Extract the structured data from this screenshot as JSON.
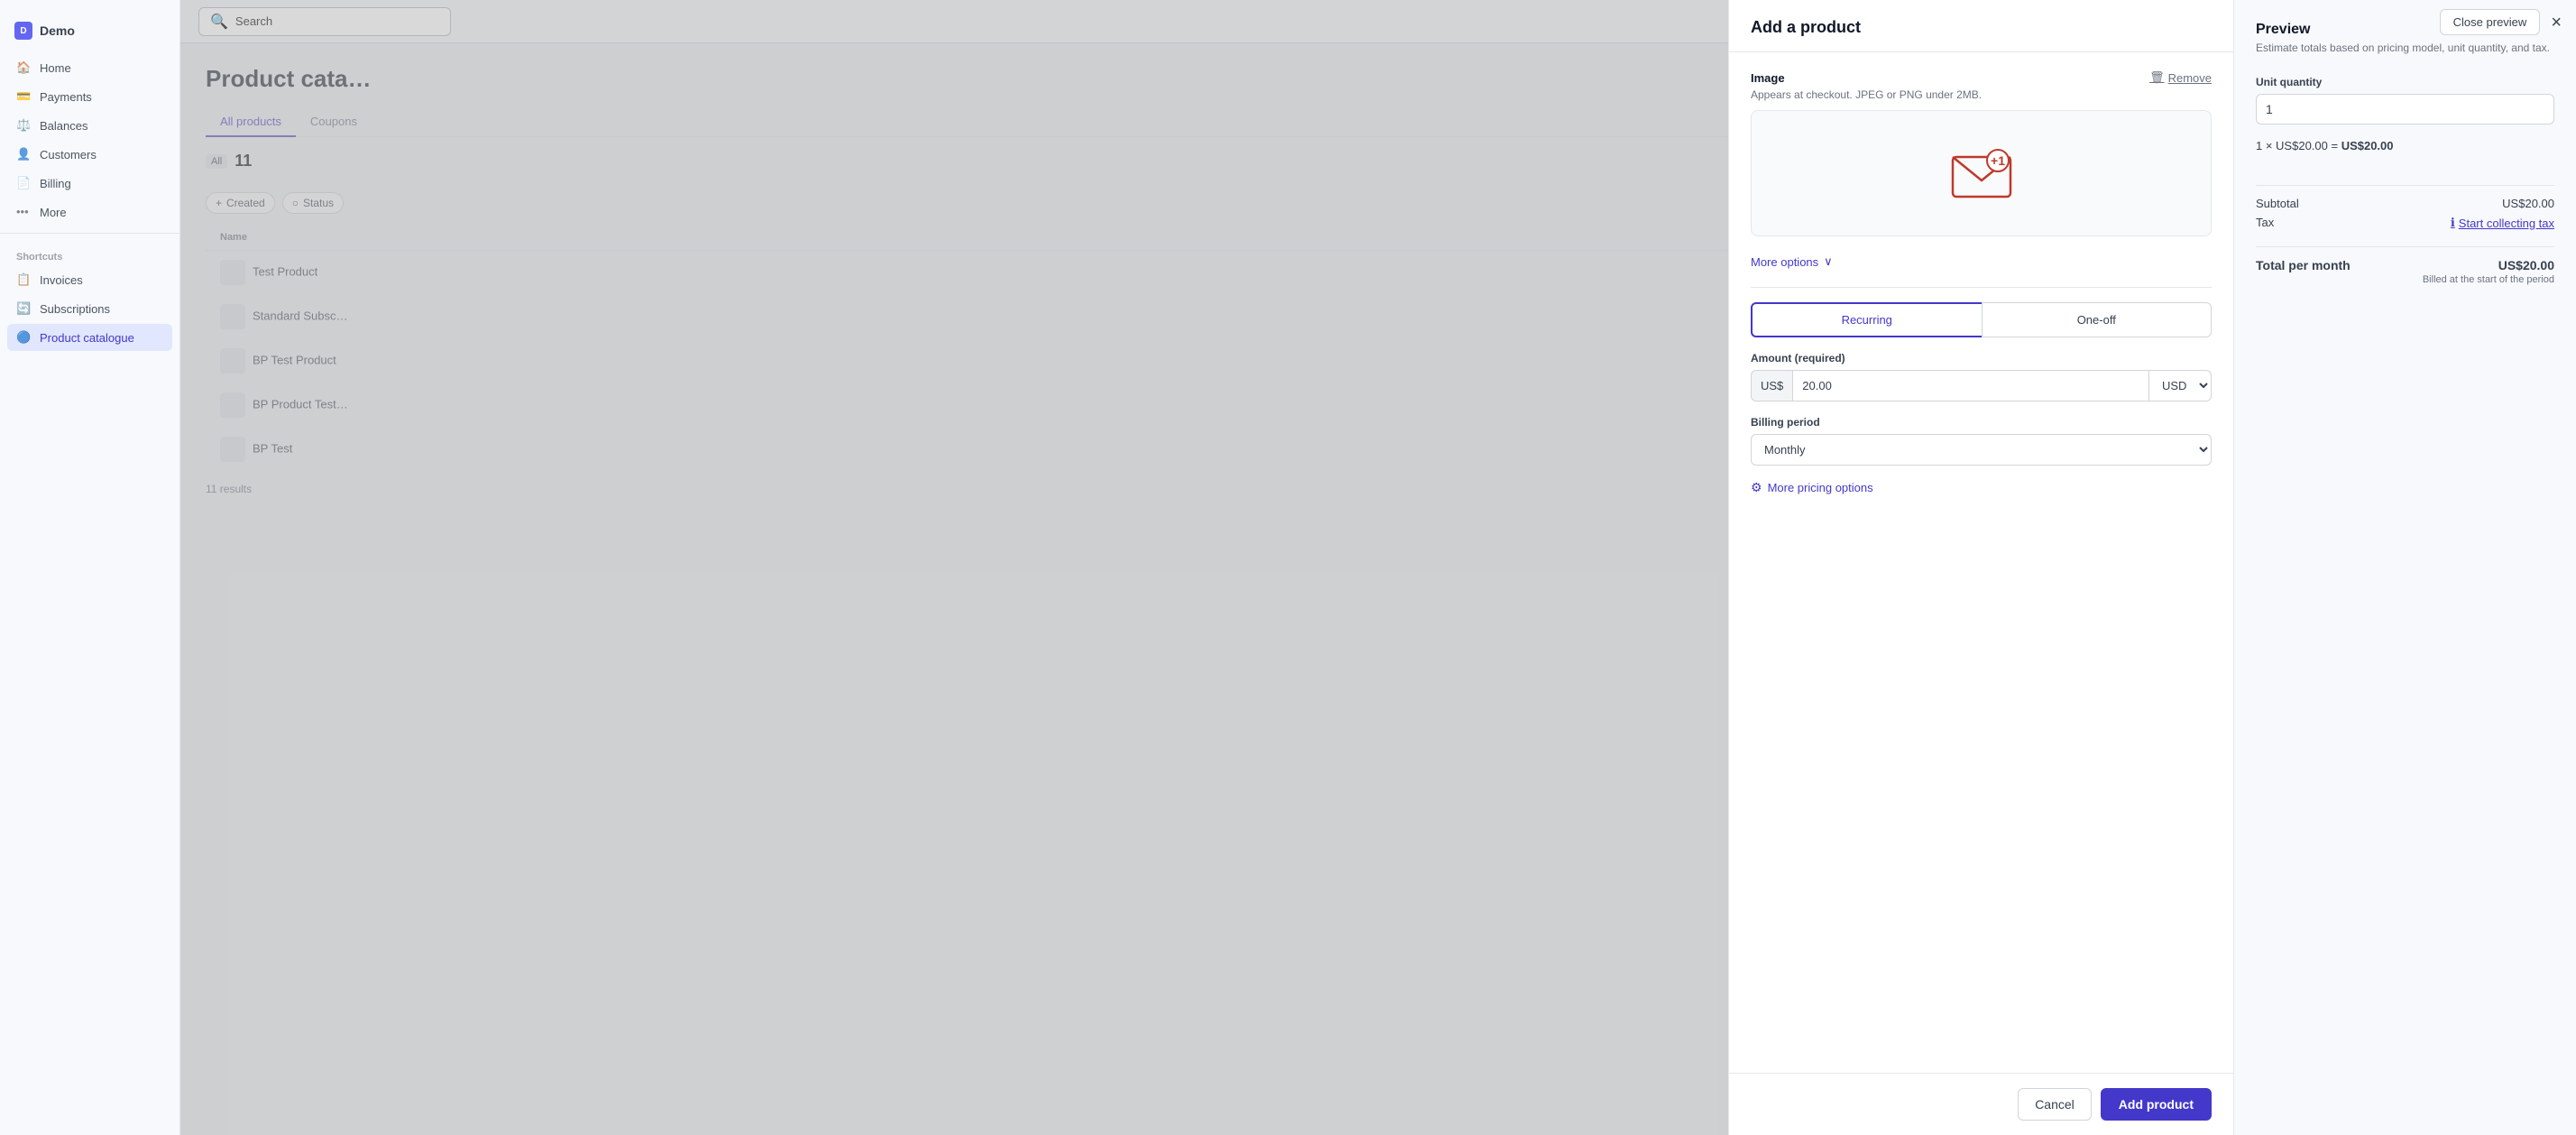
{
  "app": {
    "name": "Demo"
  },
  "search": {
    "placeholder": "Search"
  },
  "sidebar": {
    "nav_items": [
      {
        "id": "home",
        "label": "Home",
        "icon": "🏠",
        "active": false
      },
      {
        "id": "payments",
        "label": "Payments",
        "icon": "💳",
        "active": false
      },
      {
        "id": "balances",
        "label": "Balances",
        "icon": "⚖️",
        "active": false
      },
      {
        "id": "customers",
        "label": "Customers",
        "icon": "👤",
        "active": false
      },
      {
        "id": "billing",
        "label": "Billing",
        "icon": "📄",
        "active": false
      },
      {
        "id": "more",
        "label": "More",
        "icon": "•••",
        "active": false
      }
    ],
    "shortcuts_label": "Shortcuts",
    "shortcuts": [
      {
        "id": "invoices",
        "label": "Invoices",
        "active": false
      },
      {
        "id": "subscriptions",
        "label": "Subscriptions",
        "active": false
      },
      {
        "id": "product-catalogue",
        "label": "Product catalogue",
        "active": true
      }
    ]
  },
  "page": {
    "title": "Product cata…",
    "tabs": [
      {
        "label": "All products",
        "active": true
      },
      {
        "label": "Coupons",
        "active": false
      }
    ],
    "filters": {
      "all_label": "All",
      "all_count": "11",
      "created_label": "Created",
      "status_label": "Status"
    },
    "table": {
      "columns": [
        "Name",
        "",
        "",
        ""
      ],
      "rows": [
        {
          "name": "Test Product"
        },
        {
          "name": "Standard Subsc…"
        },
        {
          "name": "BP Test Product"
        },
        {
          "name": "BP Product Test…"
        },
        {
          "name": "BP Test"
        }
      ],
      "results_count": "11 results"
    }
  },
  "modal": {
    "title": "Add a product",
    "image_section": {
      "label": "Image",
      "hint": "Appears at checkout. JPEG or PNG under 2MB.",
      "remove_label": "Remove"
    },
    "more_options_label": "More options",
    "pricing_tabs": [
      {
        "label": "Recurring",
        "active": true
      },
      {
        "label": "One-off",
        "active": false
      }
    ],
    "amount_section": {
      "label": "Amount (required)",
      "prefix": "US$",
      "value": "20.00",
      "currency": "USD"
    },
    "billing_period": {
      "label": "Billing period",
      "value": "Monthly"
    },
    "more_pricing_label": "More pricing options",
    "cancel_label": "Cancel",
    "add_product_label": "Add product"
  },
  "preview": {
    "title": "Preview",
    "subtitle": "Estimate totals based on pricing model, unit quantity, and tax.",
    "unit_quantity_label": "Unit quantity",
    "unit_quantity_value": "1",
    "calc_text": "1 × US$20.00 = ",
    "calc_result": "US$20.00",
    "subtotal_label": "Subtotal",
    "subtotal_value": "US$20.00",
    "tax_label": "Tax",
    "tax_link": "Start collecting tax",
    "total_label": "Total per month",
    "total_value": "US$20.00",
    "billed_note": "Billed at the start of the period",
    "close_preview_label": "Close preview",
    "close_icon": "×"
  }
}
